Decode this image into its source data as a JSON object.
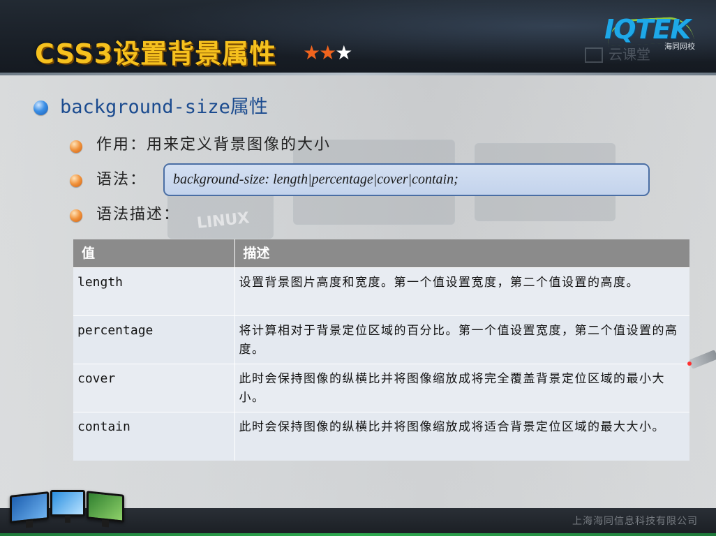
{
  "slide": {
    "title": "CSS3设置背景属性",
    "rating": {
      "filled": 2,
      "total": 3,
      "filled_glyph": "★★",
      "empty_glyph": "★"
    },
    "logo": {
      "text": "IQTEK",
      "subtitle": "海同网校"
    },
    "watermark": "云课堂"
  },
  "content": {
    "heading": "background-size属性",
    "purpose": "作用：用来定义背景图像的大小",
    "syntax_label": "语法：",
    "syntax_code": "background-size: length|percentage|cover|contain;",
    "description_label": "语法描述："
  },
  "table": {
    "headers": [
      "值",
      "描述"
    ],
    "rows": [
      {
        "value": "length",
        "description": "设置背景图片高度和宽度。第一个值设置宽度，第二个值设置的高度。"
      },
      {
        "value": "percentage",
        "description": "将计算相对于背景定位区域的百分比。第一个值设置宽度，第二个值设置的高度。"
      },
      {
        "value": "cover",
        "description": "此时会保持图像的纵横比并将图像缩放成将完全覆盖背景定位区域的最小大小。"
      },
      {
        "value": "contain",
        "description": "此时会保持图像的纵横比并将图像缩放成将适合背景定位区域的最大大小。"
      }
    ]
  },
  "background_text": "LINUX",
  "footer": {
    "company": "上海海同信息科技有限公司"
  },
  "colors": {
    "title": "#f6c11e",
    "heading": "#1b4b8f",
    "star_filled": "#f1641e",
    "star_empty": "#ffffff",
    "syntax_box_border": "#4a6ea4",
    "table_header": "#8b8b8b"
  }
}
